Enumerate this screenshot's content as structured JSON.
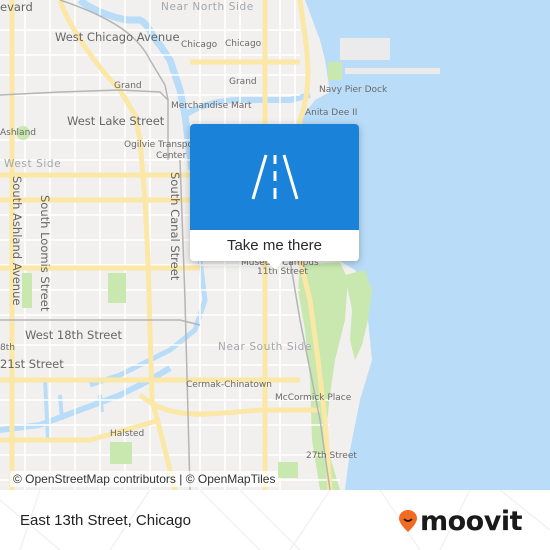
{
  "map": {
    "labels": {
      "boulevard": "evard",
      "near_north_side": "Near North Side",
      "west_chicago_avenue": "West Chicago Avenue",
      "chicago_1": "Chicago",
      "chicago_2": "Chicago",
      "grand_1": "Grand",
      "grand_2": "Grand",
      "merchandise_mart": "Merchandise Mart",
      "west_lake_street": "West Lake Street",
      "ashland": "Ashland",
      "ogilvie_line1": "Ogilvie Transport",
      "ogilvie_line2": "Center",
      "west_side": "West Side",
      "navy_pier_dock": "Navy Pier Dock",
      "anita_dee": "Anita Dee II",
      "south_ashland_avenue": "South Ashland Avenue",
      "south_loomis_street": "South Loomis Street",
      "south_canal_street": "South Canal Street",
      "museum_campus_line1": "Museum Campus",
      "museum_campus_line2": "11th Street",
      "west_18th_street": "West 18th Street",
      "street_18th": "8th",
      "street_21st": "21st Street",
      "near_south_side": "Near South Side",
      "cermak_chinatown": "Cermak-Chinatown",
      "mccormick_place": "McCormick Place",
      "halsted": "Halsted",
      "street_27th": "27th Street"
    },
    "attribution": "© OpenStreetMap contributors | © OpenMapTiles",
    "colors": {
      "land": "#f1f0ee",
      "water": "#b9dcf8",
      "major_road": "#fbe7a6",
      "park": "#c8e8b0",
      "rail": "#b0b0b0"
    }
  },
  "popup": {
    "icon": "road-icon",
    "button_label": "Take me there",
    "color": "#1a82d9"
  },
  "footer": {
    "place_name": "East 13th Street, Chicago",
    "brand": "moovit",
    "brand_color": "#f26b21"
  }
}
